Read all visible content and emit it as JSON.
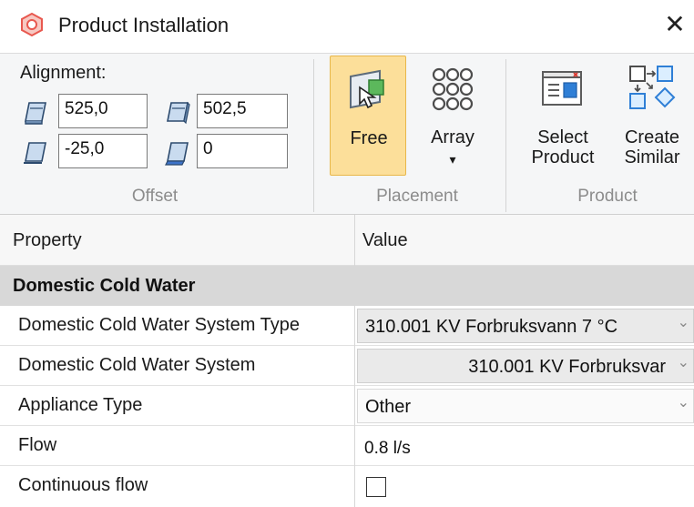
{
  "window": {
    "title": "Product Installation",
    "close_glyph": "✕"
  },
  "ribbon": {
    "offset_group": {
      "alignment_label": "Alignment:",
      "fields": {
        "top_left": "525,0",
        "top_right": "502,5",
        "bottom_left": "-25,0",
        "bottom_right": "0"
      },
      "group_label": "Offset"
    },
    "placement_group": {
      "free_label": "Free",
      "array_label": "Array",
      "array_dropdown_glyph": "▾",
      "group_label": "Placement"
    },
    "product_group": {
      "select_label_1": "Select",
      "select_label_2": "Product",
      "create_label_1": "Create",
      "create_label_2": "Similar",
      "group_label": "Product"
    }
  },
  "grid": {
    "header": {
      "property": "Property",
      "value": "Value"
    },
    "category": "Domestic Cold Water",
    "rows": [
      {
        "name": "Domestic Cold Water System Type",
        "value": "310.001 KV Forbruksvann   7 °C"
      },
      {
        "name": "Domestic Cold Water System",
        "value": "310.001 KV Forbruksvar"
      },
      {
        "name": "Appliance Type",
        "value": "Other"
      },
      {
        "name": "Flow",
        "value": "0.8  l/s"
      },
      {
        "name": "Continuous flow",
        "checked": false
      }
    ]
  },
  "icons": {
    "app": "product-installation-icon",
    "close": "close-icon",
    "offset": "offset-plane-icon",
    "free": "free-placement-icon",
    "array": "array-grid-icon",
    "select_product": "select-product-icon",
    "create_similar": "create-similar-icon",
    "dropdown": "chevron-down-icon"
  },
  "colors": {
    "active_button_bg": "#fcdf9a",
    "category_bg": "#d8d8d8",
    "ribbon_bg": "#f5f6f7",
    "accent": "#e8584f"
  }
}
